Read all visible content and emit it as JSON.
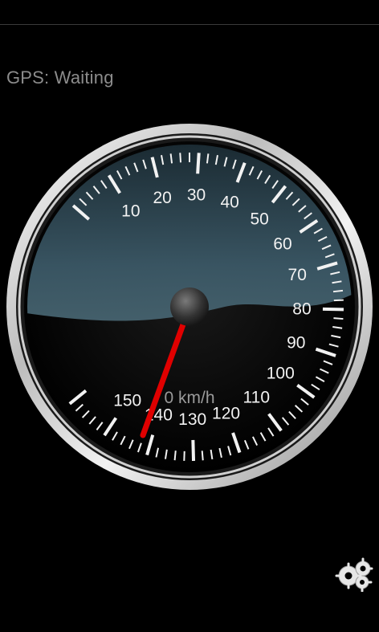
{
  "status": {
    "gps_label": "GPS: Waiting"
  },
  "speedometer": {
    "speed_text": "0 km/h",
    "min": 0,
    "max": 160,
    "tick_labels": [
      "10",
      "20",
      "30",
      "40",
      "50",
      "60",
      "70",
      "80",
      "90",
      "100",
      "110",
      "120",
      "130",
      "140",
      "150"
    ],
    "needle_color": "#e00000",
    "bezel_color": "#d9d9d9",
    "face_color": "#0b0b0b",
    "glare_color": "#2a4250"
  },
  "controls": {
    "settings_icon": "gears-icon"
  }
}
